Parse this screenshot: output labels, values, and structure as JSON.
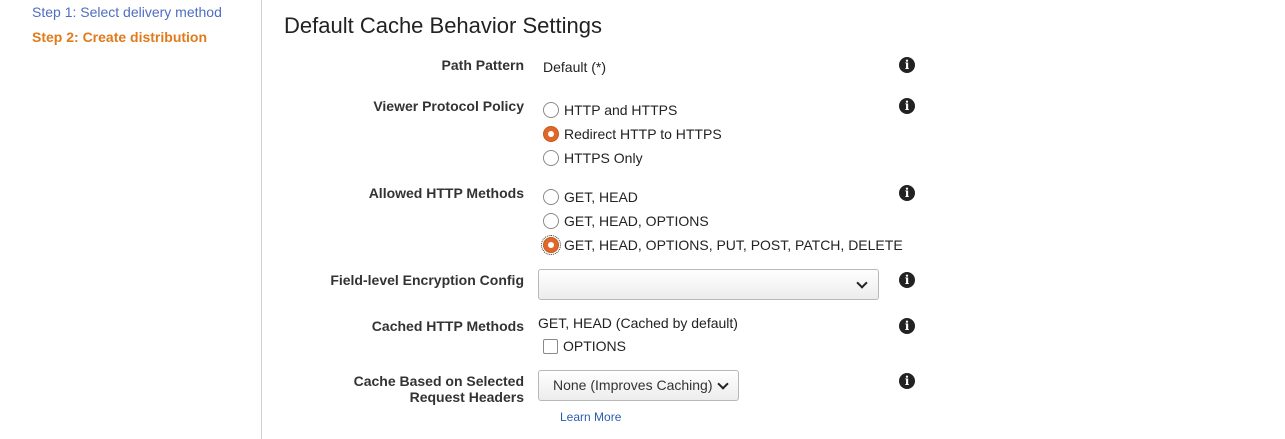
{
  "sidebar": {
    "step1": "Step 1: Select delivery method",
    "step2": "Step 2: Create distribution"
  },
  "section": {
    "title": "Default Cache Behavior Settings"
  },
  "path_pattern": {
    "label": "Path Pattern",
    "value": "Default (*)"
  },
  "viewer_protocol": {
    "label": "Viewer Protocol Policy",
    "options": [
      "HTTP and HTTPS",
      "Redirect HTTP to HTTPS",
      "HTTPS Only"
    ],
    "selected": "Redirect HTTP to HTTPS"
  },
  "allowed_methods": {
    "label": "Allowed HTTP Methods",
    "options": [
      "GET, HEAD",
      "GET, HEAD, OPTIONS",
      "GET, HEAD, OPTIONS, PUT, POST, PATCH, DELETE"
    ],
    "selected": "GET, HEAD, OPTIONS, PUT, POST, PATCH, DELETE"
  },
  "fle_config": {
    "label": "Field-level Encryption Config",
    "value": ""
  },
  "cached_methods": {
    "label": "Cached HTTP Methods",
    "value": "GET, HEAD (Cached by default)",
    "checkbox_label": "OPTIONS",
    "checked": false
  },
  "cache_headers": {
    "label_line1": "Cache Based on Selected",
    "label_line2": "Request Headers",
    "selected": "None (Improves Caching)",
    "learn_more": "Learn More"
  },
  "icons": {
    "info": "info-icon",
    "chevron": "chevron-down-icon"
  },
  "colors": {
    "accent_orange": "#e07b1a",
    "radio_checked": "#e0672a",
    "link_blue": "#2a5db0",
    "step_blue": "#4f6ec2"
  }
}
